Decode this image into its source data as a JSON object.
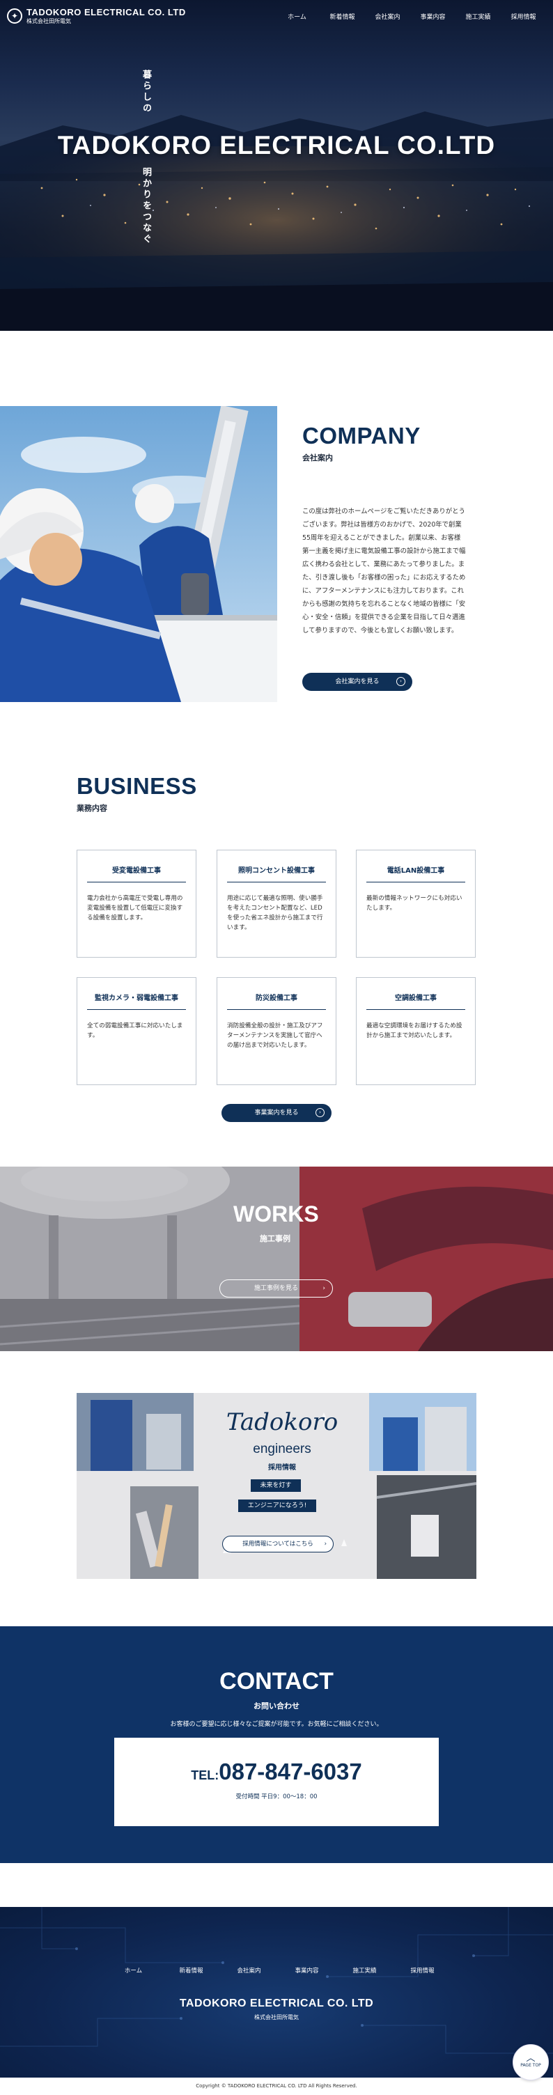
{
  "header": {
    "logo_en": "TADOKORO ELECTRICAL CO. LTD",
    "logo_jp": "株式会社田所電気",
    "nav": [
      "ホーム",
      "新着情報",
      "会社案内",
      "事業内容",
      "施工実績",
      "採用情報"
    ]
  },
  "hero": {
    "title": "TADOKORO ELECTRICAL CO.LTD",
    "copy_top": "暮らしの",
    "copy_bottom": "明かりをつなぐ"
  },
  "company": {
    "title": "COMPANY",
    "subtitle": "会社案内",
    "body": "この度は弊社のホームページをご覧いただきありがとうございます。弊社は皆様方のおかげで、2020年で創業55周年を迎えることができました。創業以来、お客様第一主義を掲げ主に電気設備工事の設計から施工まで幅広く携わる会社として、業務にあたって参りました。また、引き渡し後も「お客様の困った」にお応えするために、アフターメンテナンスにも注力しております。これからも感謝の気持ちを忘れることなく地域の皆様に「安心・安全・信頼」を提供できる企業を目指して日々邁進して参りますので、今後とも宜しくお願い致します。",
    "button": "会社案内を見る"
  },
  "business": {
    "title": "BUSINESS",
    "subtitle": "業務内容",
    "cards": [
      {
        "title": "受変電設備工事",
        "text": "電力会社から高電圧で受電し専用の変電設備を設置して低電圧に変換する設備を設置します。"
      },
      {
        "title": "照明コンセント設備工事",
        "text": "用途に応じて最適な照明、使い勝手を考えたコンセント配置など、LEDを使った省エネ設計から施工まで行います。"
      },
      {
        "title": "電話LAN設備工事",
        "text": "最新の情報ネットワークにも対応いたします。"
      },
      {
        "title": "監視カメラ・弱電設備工事",
        "text": "全ての弱電設備工事に対応いたします。"
      },
      {
        "title": "防災設備工事",
        "text": "消防設備全般の設計・施工及びアフターメンテナンスを実施して官庁への届け出まで対応いたします。"
      },
      {
        "title": "空調設備工事",
        "text": "最適な空調環境をお届けするため設計から施工まで対応いたします。"
      }
    ],
    "button": "事業案内を見る"
  },
  "works": {
    "title": "WORKS",
    "subtitle": "施工事例",
    "button": "施工事例を見る"
  },
  "recruit": {
    "script_logo": "Tadokoro",
    "engineers": "engineers",
    "heading": "採用情報",
    "tag1": "未来を灯す",
    "tag2": "エンジニアになろう!",
    "button": "採用情報についてはこちら"
  },
  "contact": {
    "title": "CONTACT",
    "subtitle": "お問い合わせ",
    "desc": "お客様のご要望に応じ様々なご提案が可能です。お気軽にご相談ください。",
    "tel_label": "TEL:",
    "tel_number": "087-847-6037",
    "hours": "受付時間 平日9：00～18：00"
  },
  "footer": {
    "nav": [
      "ホーム",
      "新着情報",
      "会社案内",
      "事業内容",
      "施工実績",
      "採用情報"
    ],
    "title": "TADOKORO ELECTRICAL CO. LTD",
    "subtitle": "株式会社田所電気",
    "copyright": "Copyright © TADOKORO ELECTRICAL CO. LTD All Rights Reserved.",
    "pagetop": "PAGE TOP"
  },
  "colors": {
    "navy": "#0f3057",
    "contact_bg": "#0f3366"
  }
}
